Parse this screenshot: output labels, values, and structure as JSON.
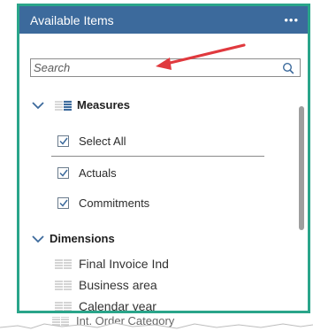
{
  "header": {
    "title": "Available Items",
    "menu_label": "•••"
  },
  "search": {
    "placeholder": "Search",
    "value": ""
  },
  "measures": {
    "title": "Measures",
    "select_all": {
      "label": "Select All",
      "checked": true
    },
    "items": [
      {
        "label": "Actuals",
        "checked": true
      },
      {
        "label": "Commitments",
        "checked": true
      }
    ]
  },
  "dimensions": {
    "title": "Dimensions",
    "items": [
      {
        "label": "Final Invoice Ind"
      },
      {
        "label": "Business area"
      },
      {
        "label": "Calendar year"
      },
      {
        "label": "Int. Order Category"
      }
    ]
  },
  "colors": {
    "header_bg": "#3c6a9c",
    "border": "#2aa58a",
    "arrow": "#e0393e",
    "icon_blue": "#3c6a9c"
  }
}
